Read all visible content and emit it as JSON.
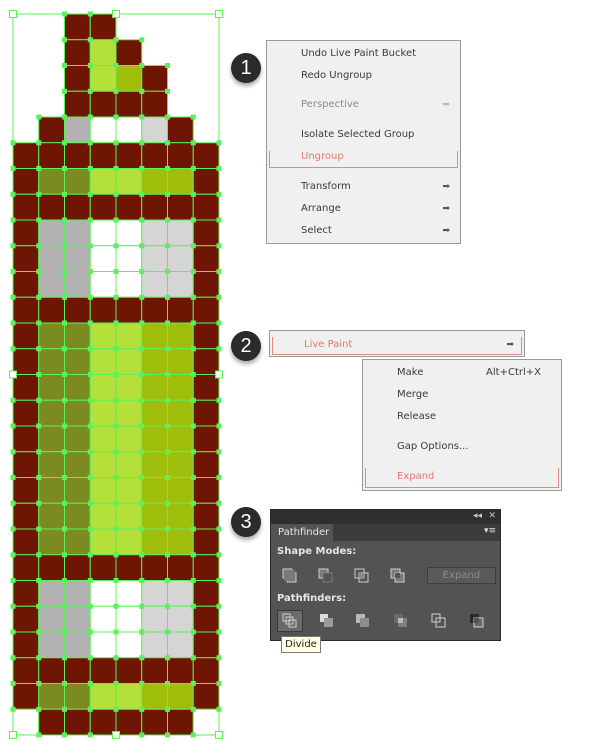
{
  "pixel_art": {
    "legend": {
      "B": "#6e1603",
      "O": "#7b8b1f",
      "L": "#b4e03a",
      "M": "#9fbe0b",
      "G": "#b2b2b2",
      "g": "#d5d5d5",
      "W": "#ffffff",
      ".": null
    },
    "rows": [
      "..BB....",
      "..BLB...",
      "..BLMB..",
      "..BBBB..",
      ".BGWWgB.",
      "BBBBBBBB",
      "BOOLLMMB",
      "BBBBBBBB",
      "BGGWWggB",
      "BGGWWggB",
      "BGGWWggB",
      "BBBBBBBB",
      "BOOLLMMB",
      "BOOLLMMB",
      "BOOLLMMB",
      "BOOLLMMB",
      "BOOLLMMB",
      "BOOLLMMB",
      "BOOLLMMB",
      "BOOLLMMB",
      "BOOLLMMB",
      "BBBBBBBB",
      "BGGWWggB",
      "BGGWWggB",
      "BGGWWggB",
      "BBBBBBBB",
      "BOOLLMMB",
      "WBBBBBBW"
    ],
    "selection_color": "#5cf05a"
  },
  "steps": [
    "1",
    "2",
    "3"
  ],
  "context_menu": {
    "items": [
      {
        "label": "Undo Live Paint Bucket",
        "state": "normal",
        "submenu": false
      },
      {
        "label": "Redo Ungroup",
        "state": "normal",
        "submenu": false
      },
      {
        "label": "Perspective",
        "state": "disabled",
        "submenu": true
      },
      {
        "label": "Isolate Selected Group",
        "state": "normal",
        "submenu": false
      },
      {
        "label": "Ungroup",
        "state": "highlighted",
        "submenu": false
      },
      {
        "label": "Transform",
        "state": "normal",
        "submenu": true
      },
      {
        "label": "Arrange",
        "state": "normal",
        "submenu": true
      },
      {
        "label": "Select",
        "state": "normal",
        "submenu": true
      }
    ]
  },
  "live_paint_menu": {
    "label": "Live Paint",
    "submenu_items": [
      {
        "label": "Make",
        "shortcut": "Alt+Ctrl+X"
      },
      {
        "label": "Merge",
        "shortcut": ""
      },
      {
        "label": "Release",
        "shortcut": ""
      },
      {
        "label": "Gap Options...",
        "shortcut": ""
      },
      {
        "label": "Expand",
        "shortcut": "",
        "state": "highlighted"
      }
    ]
  },
  "pathfinder_panel": {
    "tab_label": "Pathfinder",
    "collapse_glyph": "◂◂",
    "close_glyph": "✕",
    "menu_glyph": "▾≡",
    "shape_modes_label": "Shape Modes:",
    "shape_modes": [
      "Unite",
      "Minus Front",
      "Intersect",
      "Exclude"
    ],
    "expand_label": "Expand",
    "pathfinders_label": "Pathfinders:",
    "pathfinders": [
      "Divide",
      "Trim",
      "Merge",
      "Crop",
      "Outline",
      "Minus Back"
    ],
    "active_pathfinder": "Divide",
    "tooltip": "Divide"
  },
  "arrow_glyph": "➡"
}
